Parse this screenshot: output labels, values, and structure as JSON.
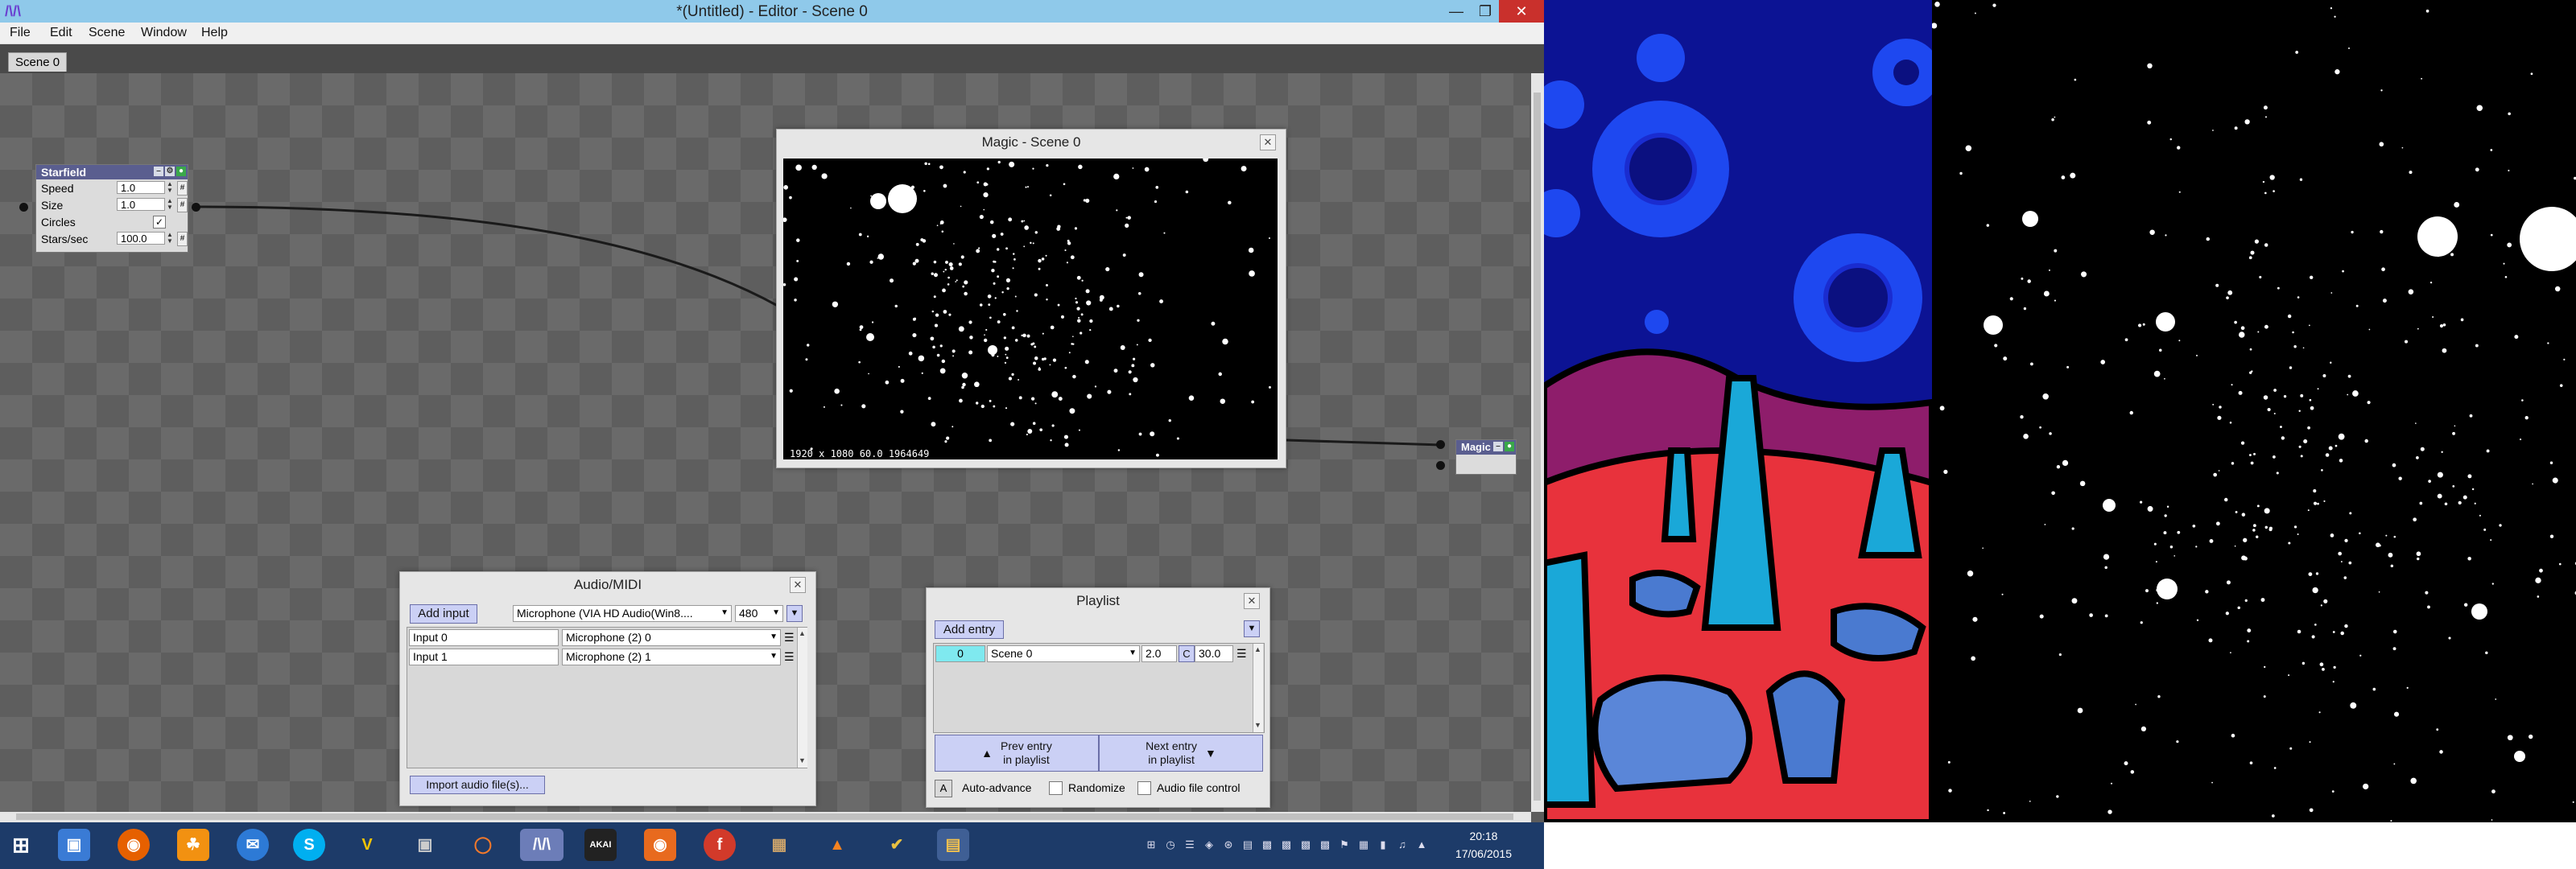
{
  "window": {
    "title": "*(Untitled) - Editor - Scene 0",
    "app_icon": "magic-logo-icon"
  },
  "menu": [
    "File",
    "Edit",
    "Scene",
    "Window",
    "Help"
  ],
  "tabs": [
    "Scene 0"
  ],
  "starfield_node": {
    "title": "Starfield",
    "params": [
      {
        "label": "Speed",
        "value": "1.0"
      },
      {
        "label": "Size",
        "value": "1.0"
      },
      {
        "label": "Circles",
        "value": "✓"
      },
      {
        "label": "Stars/sec",
        "value": "100.0"
      }
    ]
  },
  "magic_node": {
    "title": "Magic"
  },
  "preview": {
    "title": "Magic - Scene 0",
    "status": "1920 x 1080  60.0  1964649"
  },
  "audio_midi": {
    "title": "Audio/MIDI",
    "add_input": "Add input",
    "device": "Microphone (VIA HD Audio(Win8....",
    "buffer": "480",
    "inputs": [
      {
        "name": "Input 0",
        "channel": "Microphone (2) 0"
      },
      {
        "name": "Input 1",
        "channel": "Microphone (2) 1"
      }
    ],
    "import_btn": "Import audio file(s)..."
  },
  "playlist": {
    "title": "Playlist",
    "add_entry": "Add entry",
    "entry": {
      "index": "0",
      "scene": "Scene 0",
      "duration": "2.0",
      "mode": "C",
      "value": "30.0"
    },
    "prev": "Prev entry\nin playlist",
    "next": "Next entry\nin playlist",
    "prev_line1": "Prev entry",
    "prev_line2": "in playlist",
    "next_line1": "Next entry",
    "next_line2": "in playlist",
    "auto_advance_key": "A",
    "auto_advance": "Auto-advance",
    "randomize": "Randomize",
    "audio_control": "Audio file control"
  },
  "taskbar": {
    "time": "20:18",
    "date": "17/06/2015"
  },
  "colors": {
    "titlebar": "#8fc9ea",
    "node_header": "#5a5e8f",
    "button": "#cbd0f5",
    "taskbar": "#1d3b69",
    "playlist_index": "#7fe9ef"
  }
}
